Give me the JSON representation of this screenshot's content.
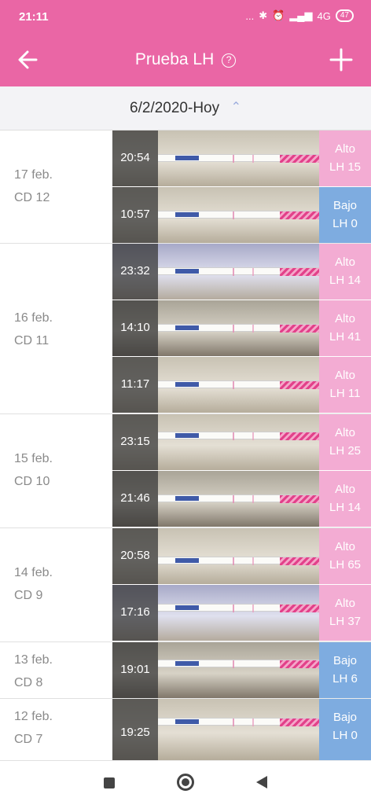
{
  "status_bar": {
    "time": "21:11",
    "signal_text": "...",
    "network": "4G",
    "battery": "47"
  },
  "header": {
    "title": "Prueba LH",
    "help_glyph": "?"
  },
  "range": {
    "label": "6/2/2020-Hoy"
  },
  "days": [
    {
      "date": "17 feb.",
      "cycle_day": "CD 12",
      "entries": [
        {
          "time": "20:54",
          "result": "Alto",
          "lh": "LH 15"
        },
        {
          "time": "10:57",
          "result": "Bajo",
          "lh": "LH 0"
        }
      ]
    },
    {
      "date": "16 feb.",
      "cycle_day": "CD 11",
      "entries": [
        {
          "time": "23:32",
          "result": "Alto",
          "lh": "LH 14"
        },
        {
          "time": "14:10",
          "result": "Alto",
          "lh": "LH 41"
        },
        {
          "time": "11:17",
          "result": "Alto",
          "lh": "LH 11"
        }
      ]
    },
    {
      "date": "15 feb.",
      "cycle_day": "CD 10",
      "entries": [
        {
          "time": "23:15",
          "result": "Alto",
          "lh": "LH 25"
        },
        {
          "time": "21:46",
          "result": "Alto",
          "lh": "LH 14"
        }
      ]
    },
    {
      "date": "14 feb.",
      "cycle_day": "CD 9",
      "entries": [
        {
          "time": "20:58",
          "result": "Alto",
          "lh": "LH 65"
        },
        {
          "time": "17:16",
          "result": "Alto",
          "lh": "LH 37"
        }
      ]
    },
    {
      "date": "13 feb.",
      "cycle_day": "CD 8",
      "entries": [
        {
          "time": "19:01",
          "result": "Bajo",
          "lh": "LH 6"
        }
      ]
    },
    {
      "date": "12 feb.",
      "cycle_day": "CD 7",
      "entries": [
        {
          "time": "19:25",
          "result": "Bajo",
          "lh": "LH 0"
        }
      ]
    }
  ],
  "colors": {
    "header": "#ea66a5",
    "alto": "#f1a0cd",
    "bajo": "#6ca0dc"
  }
}
